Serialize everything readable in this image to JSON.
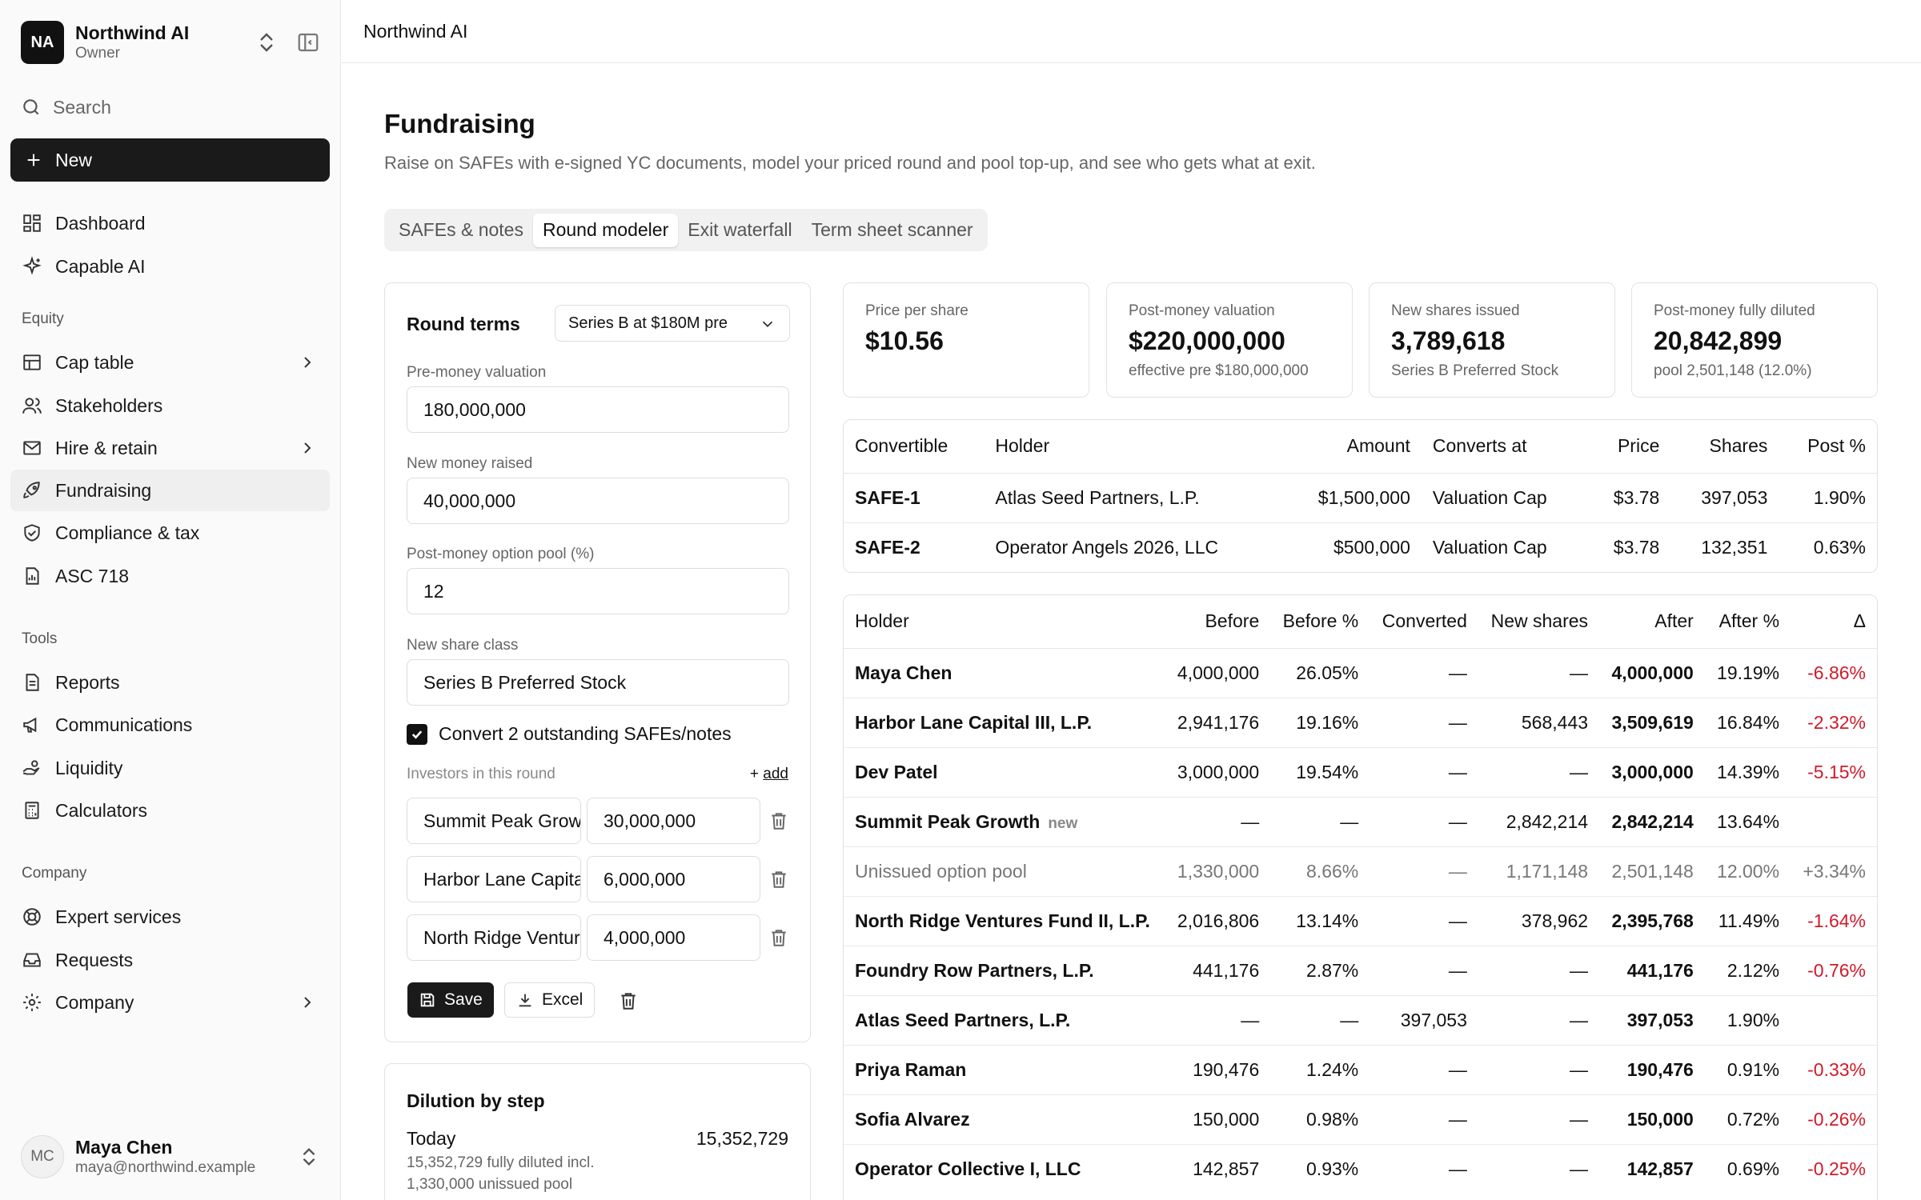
{
  "org": {
    "initials": "NA",
    "name": "Northwind AI",
    "role": "Owner"
  },
  "search": {
    "label": "Search"
  },
  "new_button": {
    "label": "New"
  },
  "nav": {
    "dashboard": "Dashboard",
    "capable_ai": "Capable AI",
    "equity_section": "Equity",
    "cap_table": "Cap table",
    "stakeholders": "Stakeholders",
    "hire_retain": "Hire & retain",
    "fundraising": "Fundraising",
    "compliance": "Compliance & tax",
    "asc718": "ASC 718",
    "tools_section": "Tools",
    "reports": "Reports",
    "communications": "Communications",
    "liquidity": "Liquidity",
    "calculators": "Calculators",
    "company_section": "Company",
    "expert_services": "Expert services",
    "requests": "Requests",
    "company": "Company"
  },
  "user": {
    "initials": "MC",
    "name": "Maya Chen",
    "email": "maya@northwind.example"
  },
  "header": {
    "breadcrumb": "Northwind AI"
  },
  "page": {
    "title": "Fundraising",
    "subtitle": "Raise on SAFEs with e-signed YC documents, model your priced round and pool top-up, and see who gets what at exit."
  },
  "tabs": [
    "SAFEs & notes",
    "Round modeler",
    "Exit waterfall",
    "Term sheet scanner"
  ],
  "round": {
    "title": "Round terms",
    "scenario": "Series B at $180M pre",
    "pre_money_label": "Pre-money valuation",
    "pre_money": "180,000,000",
    "new_money_label": "New money raised",
    "new_money": "40,000,000",
    "pool_label": "Post-money option pool (%)",
    "pool": "12",
    "class_label": "New share class",
    "class": "Series B Preferred Stock",
    "convert_label": "Convert 2 outstanding SAFEs/notes",
    "investors_label": "Investors in this round",
    "add_label": "add",
    "investors": [
      {
        "name": "Summit Peak Growth",
        "amount": "30,000,000"
      },
      {
        "name": "Harbor Lane Capital",
        "amount": "6,000,000"
      },
      {
        "name": "North Ridge Ventures",
        "amount": "4,000,000"
      }
    ],
    "save_label": "Save",
    "excel_label": "Excel"
  },
  "dilution": {
    "title": "Dilution by step",
    "step_label": "Today",
    "step_value": "15,352,729",
    "step_sub1": "15,352,729 fully diluted incl.",
    "step_sub2": "1,330,000 unissued pool"
  },
  "metrics": [
    {
      "label": "Price per share",
      "value": "$10.56",
      "sub": ""
    },
    {
      "label": "Post-money valuation",
      "value": "$220,000,000",
      "sub": "effective pre $180,000,000"
    },
    {
      "label": "New shares issued",
      "value": "3,789,618",
      "sub": "Series B Preferred Stock"
    },
    {
      "label": "Post-money fully diluted",
      "value": "20,842,899",
      "sub": "pool 2,501,148 (12.0%)"
    }
  ],
  "convertibles": {
    "headers": [
      "Convertible",
      "Holder",
      "Amount",
      "Converts at",
      "Price",
      "Shares",
      "Post %"
    ],
    "rows": [
      [
        "SAFE-1",
        "Atlas Seed Partners, L.P.",
        "$1,500,000",
        "Valuation Cap",
        "$3.78",
        "397,053",
        "1.90%"
      ],
      [
        "SAFE-2",
        "Operator Angels 2026, LLC",
        "$500,000",
        "Valuation Cap",
        "$3.78",
        "132,351",
        "0.63%"
      ]
    ]
  },
  "holders": {
    "headers": [
      "Holder",
      "Before",
      "Before %",
      "Converted",
      "New shares",
      "After",
      "After %",
      "Δ"
    ],
    "new_tag": "new",
    "rows": [
      [
        "Maya Chen",
        "4,000,000",
        "26.05%",
        "—",
        "—",
        "4,000,000",
        "19.19%",
        "-6.86%"
      ],
      [
        "Harbor Lane Capital III, L.P.",
        "2,941,176",
        "19.16%",
        "—",
        "568,443",
        "3,509,619",
        "16.84%",
        "-2.32%"
      ],
      [
        "Dev Patel",
        "3,000,000",
        "19.54%",
        "—",
        "—",
        "3,000,000",
        "14.39%",
        "-5.15%"
      ],
      [
        "Summit Peak Growth",
        "—",
        "—",
        "—",
        "2,842,214",
        "2,842,214",
        "13.64%",
        ""
      ],
      [
        "Unissued option pool",
        "1,330,000",
        "8.66%",
        "—",
        "1,171,148",
        "2,501,148",
        "12.00%",
        "+3.34%"
      ],
      [
        "North Ridge Ventures Fund II, L.P.",
        "2,016,806",
        "13.14%",
        "—",
        "378,962",
        "2,395,768",
        "11.49%",
        "-1.64%"
      ],
      [
        "Foundry Row Partners, L.P.",
        "441,176",
        "2.87%",
        "—",
        "—",
        "441,176",
        "2.12%",
        "-0.76%"
      ],
      [
        "Atlas Seed Partners, L.P.",
        "—",
        "—",
        "397,053",
        "—",
        "397,053",
        "1.90%",
        ""
      ],
      [
        "Priya Raman",
        "190,476",
        "1.24%",
        "—",
        "—",
        "190,476",
        "0.91%",
        "-0.33%"
      ],
      [
        "Sofia Alvarez",
        "150,000",
        "0.98%",
        "—",
        "—",
        "150,000",
        "0.72%",
        "-0.26%"
      ],
      [
        "Operator Collective I, LLC",
        "142,857",
        "0.93%",
        "—",
        "—",
        "142,857",
        "0.69%",
        "-0.25%"
      ]
    ]
  },
  "colors": {
    "accent": "#1a1a1a",
    "negative": "#d11a2a",
    "positive": "#16883a"
  }
}
